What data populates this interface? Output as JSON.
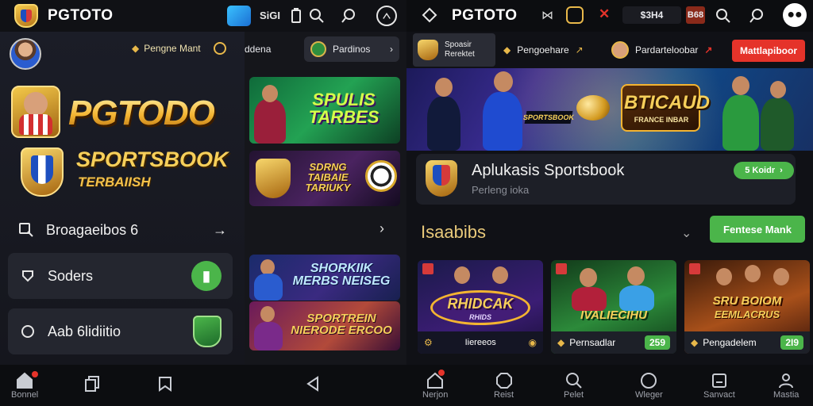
{
  "left": {
    "status_bar": {
      "brand": "PGTOTO",
      "signal_text": "SiGI"
    },
    "drawer": {
      "pill_label": "Pengne Mant",
      "hero_title": "PGTODO",
      "hero_subtitle": "SPORTSBOOK",
      "hero_caption": "TERBAIISH",
      "menu": [
        {
          "label": "Broagaeibos 6"
        },
        {
          "label": "Soders"
        },
        {
          "label": "Aab 6lidiitio"
        }
      ]
    },
    "content": {
      "chip_label": "Pardinos",
      "chip_label_left": "ddena",
      "promos": [
        {
          "title": "SPULIS TARBES"
        },
        {
          "title": "SDRNG TAIBAIE TARIUKY"
        },
        {
          "title": "SHORKIIK MERBS NEISEG"
        },
        {
          "title": "SPORTREIN NIERODE ERCOO"
        }
      ]
    },
    "bottom_nav": [
      {
        "label": "Bonnel"
      }
    ]
  },
  "right": {
    "top_bar": {
      "brand": "PGTOTO",
      "balance": "$3H4",
      "code": "B68"
    },
    "tabs": [
      {
        "label_top": "Spoasir",
        "label_bottom": "Rerektet"
      },
      {
        "label": "Pengoehare"
      },
      {
        "label": "Pardarteloobar"
      }
    ],
    "cta": "Mattlapiboor",
    "banner": {
      "title": "BTICAUD",
      "subtitle": "FRANCE INBAR",
      "tag": "SPORTSBOOK"
    },
    "app_card": {
      "title": "Aplukasis Sportsbook",
      "subtitle": "Perleng ioka",
      "badge": "5 Koidr"
    },
    "section": {
      "title": "Isaabibs",
      "button": "Fentese Mank"
    },
    "games": [
      {
        "title": "RHIDCAK",
        "subtitle": "RHIDS",
        "foot": "Iiereeos"
      },
      {
        "title": "IVALIECIHU",
        "subtitle": "",
        "foot": "Pernsadlar",
        "num": "259"
      },
      {
        "title": "SRU BOIOM",
        "subtitle": "EEMLACRUS",
        "foot": "Pengadelem",
        "num": "2I9"
      }
    ],
    "bottom_nav": [
      {
        "label": "Nerjon"
      },
      {
        "label": "Reist"
      },
      {
        "label": "Pelet"
      },
      {
        "label": "Wleger"
      },
      {
        "label": "Sanvact"
      },
      {
        "label": "Mastia"
      }
    ]
  },
  "colors": {
    "accent_green": "#4bb54a",
    "accent_red": "#e5332a",
    "gold": "#f3b431"
  }
}
